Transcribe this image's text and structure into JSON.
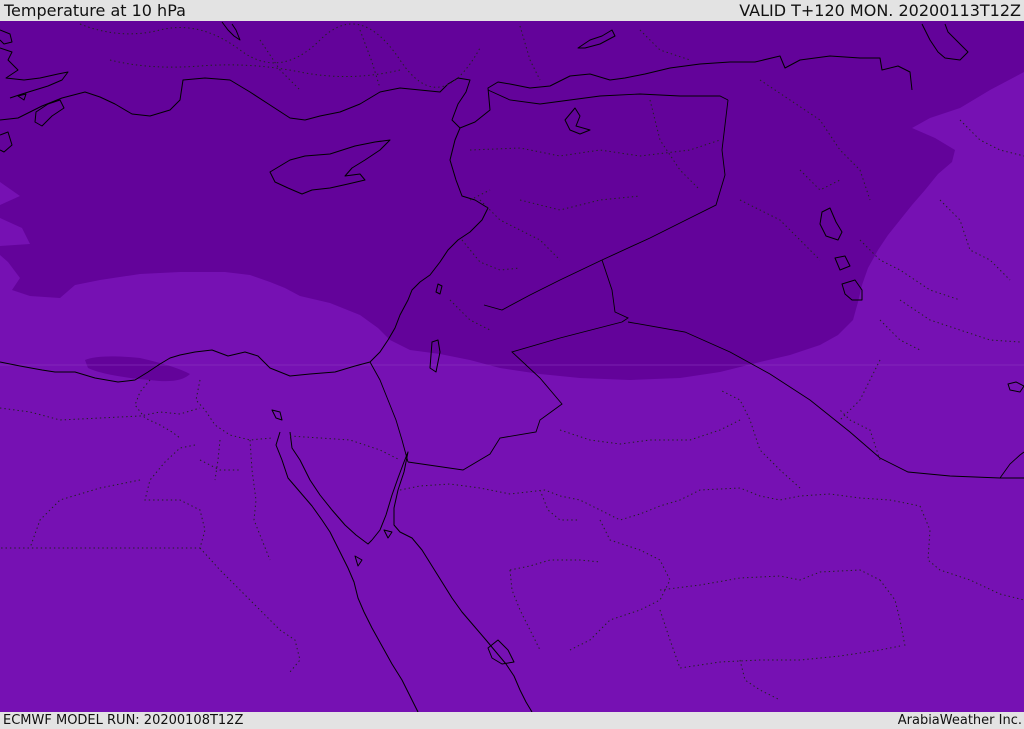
{
  "header": {
    "title": "Temperature at 10 hPa",
    "valid": "VALID T+120 MON. 20200113T12Z"
  },
  "footer": {
    "model_run": "ECMWF MODEL RUN: 20200108T12Z",
    "credit": "ArabiaWeather Inc."
  },
  "colors": {
    "cold_band": "#63039a",
    "warm_band": "#7611b3",
    "tile_seam": "#8a3bbd",
    "background": "#e3e3e3",
    "lines": "#000000"
  }
}
